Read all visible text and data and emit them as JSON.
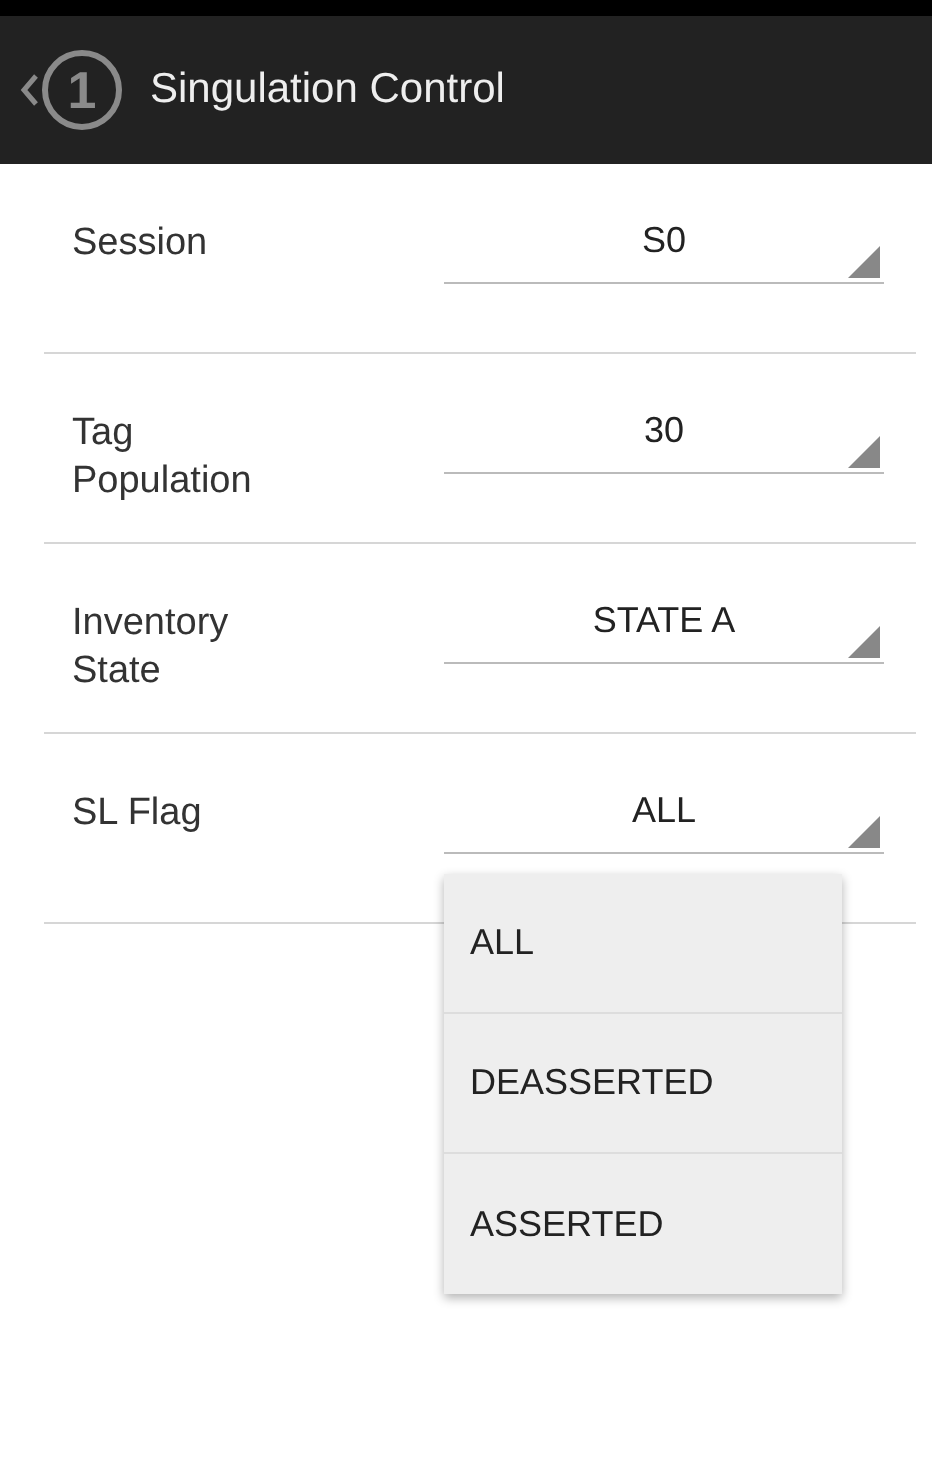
{
  "header": {
    "badge": "1",
    "title": "Singulation Control"
  },
  "settings": [
    {
      "label": "Session",
      "value": "S0"
    },
    {
      "label": "Tag Population",
      "value": "30"
    },
    {
      "label": "Inventory State",
      "value": "STATE A"
    },
    {
      "label": "SL Flag",
      "value": "ALL"
    }
  ],
  "dropdown": {
    "options": [
      {
        "label": "ALL"
      },
      {
        "label": "DEASSERTED"
      },
      {
        "label": "ASSERTED"
      }
    ]
  }
}
